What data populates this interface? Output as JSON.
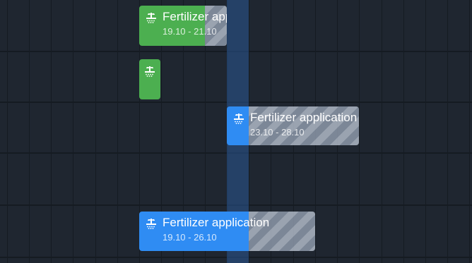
{
  "tasks": [
    {
      "title": "Fertilizer application",
      "dates": "19.10 - 21.10",
      "color": "#4caf50",
      "icon": "fertilizer-icon",
      "progress": 0.75
    },
    {
      "title": "",
      "dates": "",
      "color": "#4caf50",
      "icon": "fertilizer-icon",
      "progress": 1.0
    },
    {
      "title": "Fertilizer application",
      "dates": "23.10 - 28.10",
      "color": "#2f8cf3",
      "icon": "fertilizer-icon",
      "progress": 0.17
    },
    {
      "title": "Fertilizer application",
      "dates": "19.10 - 26.10",
      "color": "#2f8cf3",
      "icon": "fertilizer-icon",
      "progress": 0.63
    }
  ]
}
